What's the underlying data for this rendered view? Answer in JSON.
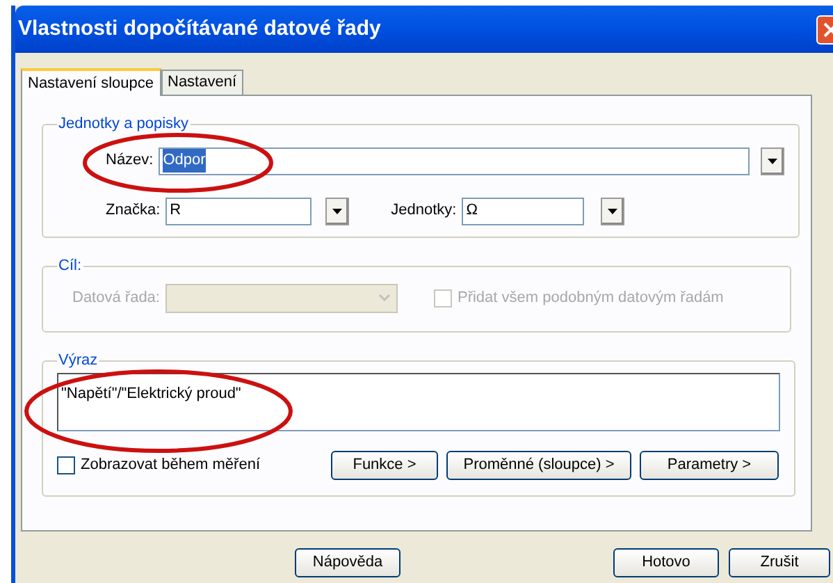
{
  "window": {
    "title": "Vlastnosti dopočítávané datové řady"
  },
  "tabs": [
    {
      "label": "Nastavení sloupce",
      "selected": true
    },
    {
      "label": "Nastavení",
      "selected": false
    }
  ],
  "units_group": {
    "title": "Jednotky a popisky",
    "name": {
      "label": "Název:",
      "value": "Odpor",
      "text_selected": true
    },
    "symbol": {
      "label": "Značka:",
      "value": "R"
    },
    "units": {
      "label": "Jednotky:",
      "value": "Ω"
    }
  },
  "target_group": {
    "title": "Cíl:",
    "disabled": true,
    "series": {
      "label": "Datová řada:"
    },
    "add_all": {
      "label": "Přidat všem podobným datovým řadám",
      "checked": false
    }
  },
  "expression_group": {
    "title": "Výraz",
    "value": "\"Napětí\"/\"Elektrický proud\"",
    "show_during": {
      "label": "Zobrazovat během měření",
      "checked": false
    },
    "buttons": [
      "Funkce >",
      "Proměnné (sloupce) >",
      "Parametry >"
    ]
  },
  "buttons": [
    "Nápověda",
    "Hotovo",
    "Zrušit"
  ]
}
